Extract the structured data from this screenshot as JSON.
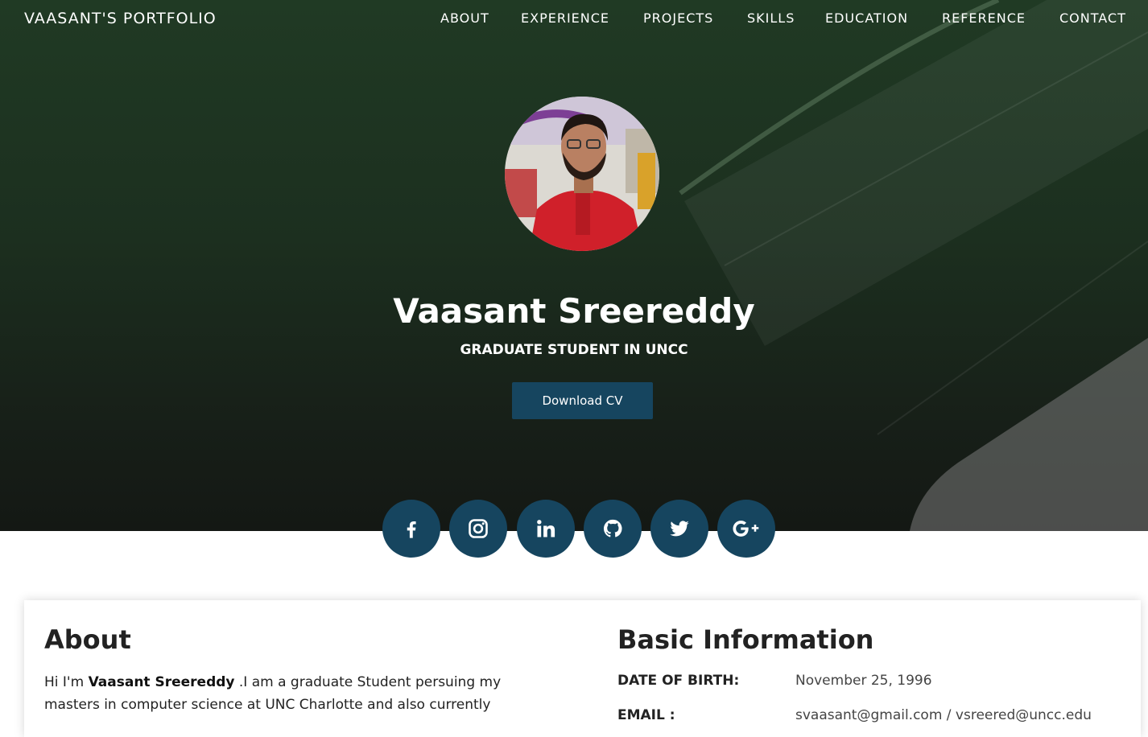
{
  "nav": {
    "brand": "VAASANT'S PORTFOLIO",
    "links": [
      "ABOUT",
      "EXPERIENCE",
      "PROJECTS",
      "SKILLS",
      "EDUCATION",
      "REFERENCE",
      "CONTACT"
    ]
  },
  "hero": {
    "name": "Vaasant Sreereddy",
    "subtitle": "GRADUATE STUDENT IN UNCC",
    "cv_button": "Download CV"
  },
  "social": {
    "icons": [
      "facebook-icon",
      "instagram-icon",
      "linkedin-icon",
      "github-icon",
      "twitter-icon",
      "google-plus-icon"
    ]
  },
  "about": {
    "title": "About",
    "intro_prefix": "Hi I'm ",
    "intro_name": "Vaasant Sreereddy",
    "intro_rest": " .I am a graduate Student persuing my masters in computer science at UNC Charlotte and also currently"
  },
  "basic_info": {
    "title": "Basic Information",
    "rows": [
      {
        "label": "DATE OF BIRTH:",
        "value": "November 25, 1996"
      },
      {
        "label": "EMAIL :",
        "value": "svaasant@gmail.com / vsreered@uncc.edu"
      }
    ]
  },
  "colors": {
    "accent": "#16455f",
    "hero_dark": "#1c2f1f",
    "text": "#222222"
  }
}
